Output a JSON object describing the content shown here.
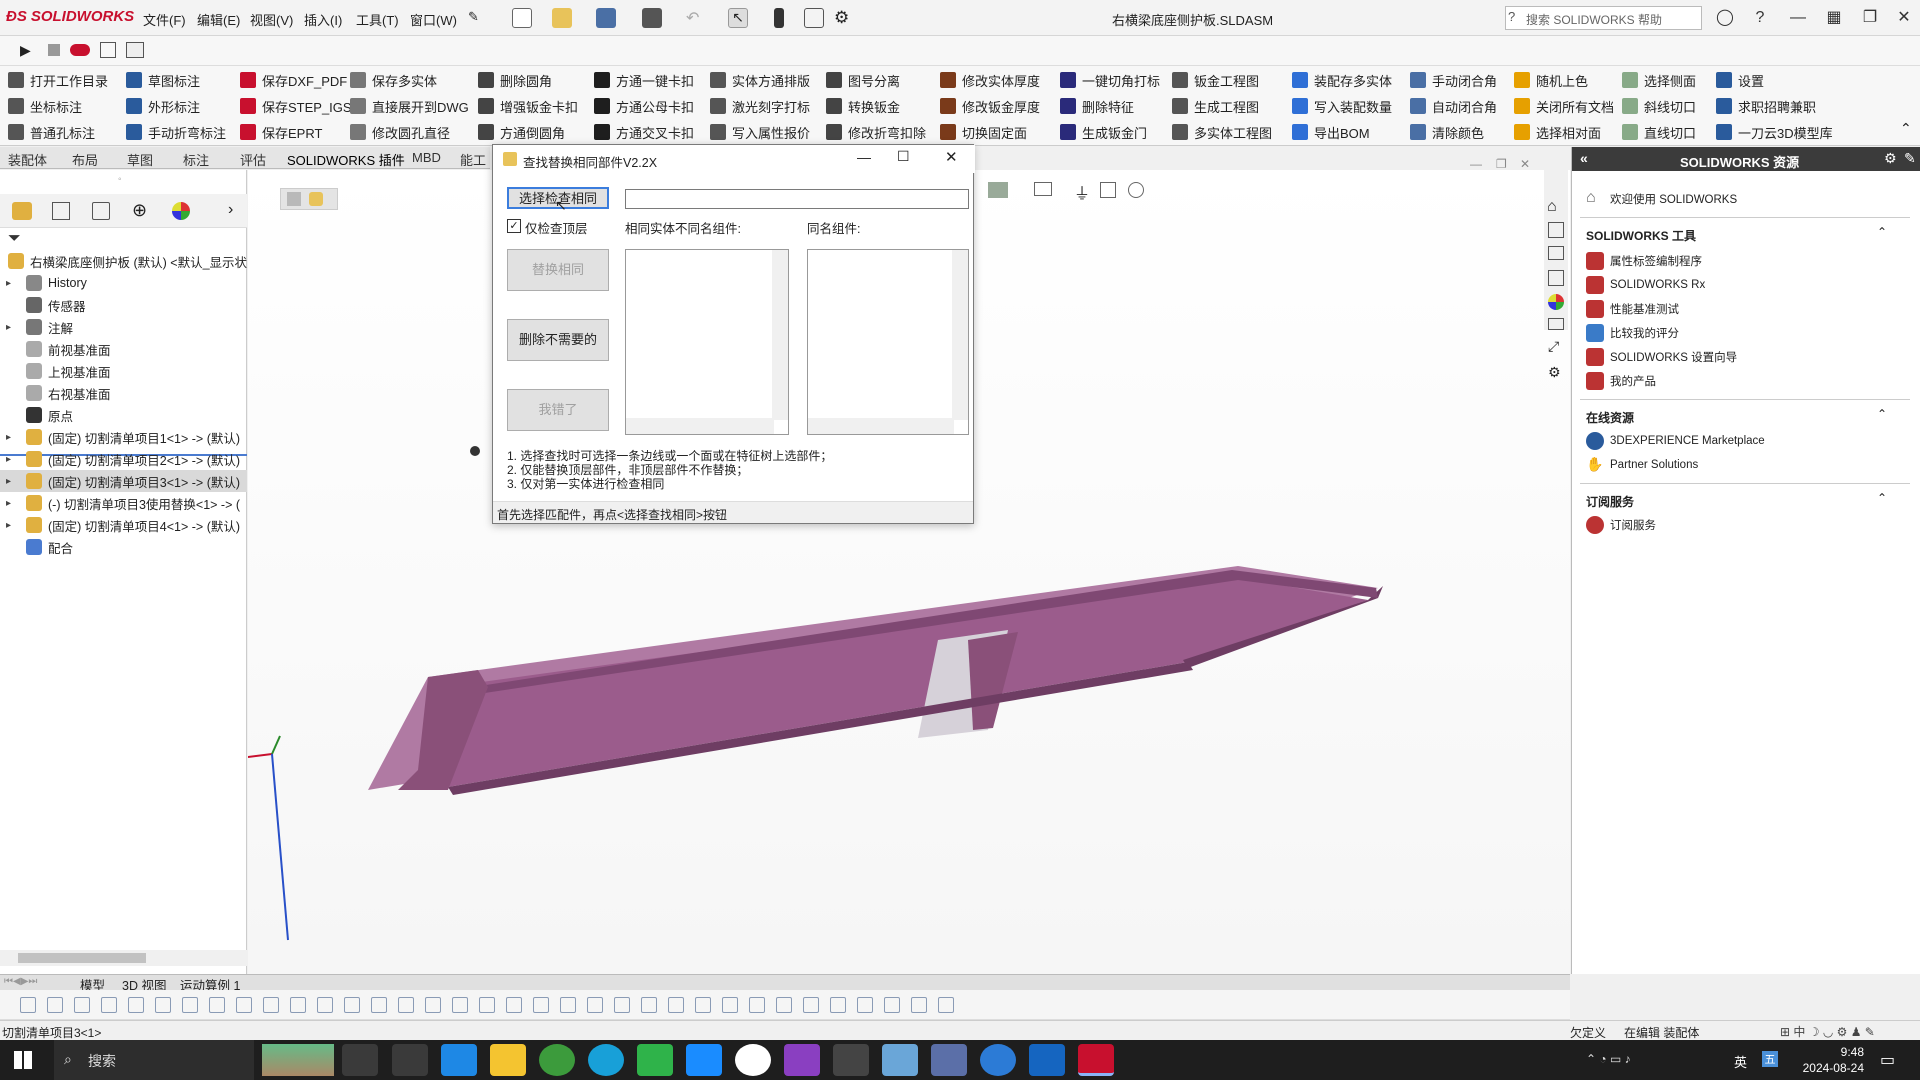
{
  "app": {
    "brand": "SOLIDWORKS",
    "document_title": "右横梁底座侧护板.SLDASM",
    "help_search_placeholder": "搜索 SOLIDWORKS 帮助",
    "menus": [
      "文件(F)",
      "编辑(E)",
      "视图(V)",
      "插入(I)",
      "工具(T)",
      "窗口(W)"
    ]
  },
  "plugin_toolbar": {
    "rows": [
      [
        "打开工作目录",
        "草图标注",
        "保存DXF_PDF",
        "保存多实体",
        "删除圆角",
        "方通一键卡扣",
        "实体方通排版",
        "图号分离",
        "修改实体厚度",
        "一键切角打标",
        "钣金工程图",
        "装配存多实体",
        "手动闭合角",
        "随机上色",
        "选择侧面",
        "设置"
      ],
      [
        "坐标标注",
        "外形标注",
        "保存STEP_IGS",
        "直接展开到DWG",
        "增强钣金卡扣",
        "方通公母卡扣",
        "激光刻字打标",
        "转换钣金",
        "修改钣金厚度",
        "删除特征",
        "生成工程图",
        "写入装配数量",
        "自动闭合角",
        "关闭所有文档",
        "斜线切口",
        "求职招聘兼职"
      ],
      [
        "普通孔标注",
        "手动折弯标注",
        "保存EPRT",
        "修改圆孔直径",
        "方通倒圆角",
        "方通交叉卡扣",
        "写入属性报价",
        "修改折弯扣除",
        "切换固定面",
        "生成钣金门",
        "多实体工程图",
        "导出BOM",
        "清除颜色",
        "选择相对面",
        "直线切口",
        "一刀云3D模型库"
      ]
    ],
    "prefixes": [
      "STEP",
      "DWG",
      "EPRT"
    ]
  },
  "command_tabs": [
    "装配体",
    "布局",
    "草图",
    "标注",
    "评估",
    "SOLIDWORKS 插件",
    "MBD",
    "能工"
  ],
  "feature_tree": {
    "root": "右横梁底座侧护板 (默认) <默认_显示状",
    "items": [
      {
        "label": "History",
        "expand": true
      },
      {
        "label": "传感器",
        "expand": false
      },
      {
        "label": "注解",
        "expand": true
      },
      {
        "label": "前视基准面",
        "expand": false
      },
      {
        "label": "上视基准面",
        "expand": false
      },
      {
        "label": "右视基准面",
        "expand": false
      },
      {
        "label": "原点",
        "expand": false
      },
      {
        "label": "(固定) 切割清单项目1<1> -> (默认)",
        "expand": true
      },
      {
        "label": "(固定) 切割清单项目2<1> -> (默认)",
        "expand": true
      },
      {
        "label": "(固定) 切割清单项目3<1> -> (默认)",
        "expand": true,
        "selected": true
      },
      {
        "label": "(-) 切割清单项目3使用替换<1> -> (",
        "expand": true
      },
      {
        "label": "(固定) 切割清单项目4<1> -> (默认)",
        "expand": true
      },
      {
        "label": "配合",
        "expand": false
      }
    ]
  },
  "dialog": {
    "title": "查找替换相同部件V2.2X",
    "select_button": "选择检查相同",
    "checkbox_label": "仅检查顶层",
    "checkbox_checked": true,
    "replace_button": "替换相同",
    "delete_button": "删除不需要的",
    "done_button": "我错了",
    "input_value": "",
    "list1_label": "相同实体不同名组件:",
    "list2_label": "同名组件:",
    "notes": [
      "1. 选择查找时可选择一条边线或一个面或在特征树上选部件；",
      "2. 仅能替换顶层部件，非顶层部件不作替换；",
      "3. 仅对第一实体进行检查相同"
    ],
    "status": "首先选择匹配件，再点<选择查找相同>按钮"
  },
  "resources_panel": {
    "title": "SOLIDWORKS 资源",
    "welcome": "欢迎使用 SOLIDWORKS",
    "tools_header": "SOLIDWORKS 工具",
    "tools": [
      "属性标签编制程序",
      "SOLIDWORKS Rx",
      "性能基准测试",
      "比较我的评分",
      "SOLIDWORKS 设置向导",
      "我的产品"
    ],
    "online_header": "在线资源",
    "online": [
      "3DEXPERIENCE Marketplace",
      "Partner Solutions"
    ],
    "subscription_header": "订阅服务",
    "subscription": [
      "订阅服务"
    ]
  },
  "bottom_tabs": [
    "模型",
    "3D 视图",
    "运动算例 1"
  ],
  "status_bar": {
    "left": "切割清单项目3<1>",
    "right1": "欠定义",
    "right2": "在编辑 装配体"
  },
  "taskbar": {
    "search": "搜索",
    "time": "9:48",
    "date": "2024-08-24",
    "lang": "英"
  },
  "colors": {
    "part": "#9b5c8c",
    "part_dark": "#6e3d63",
    "part_light": "#b07aa3",
    "accent_red": "#c8102e"
  }
}
